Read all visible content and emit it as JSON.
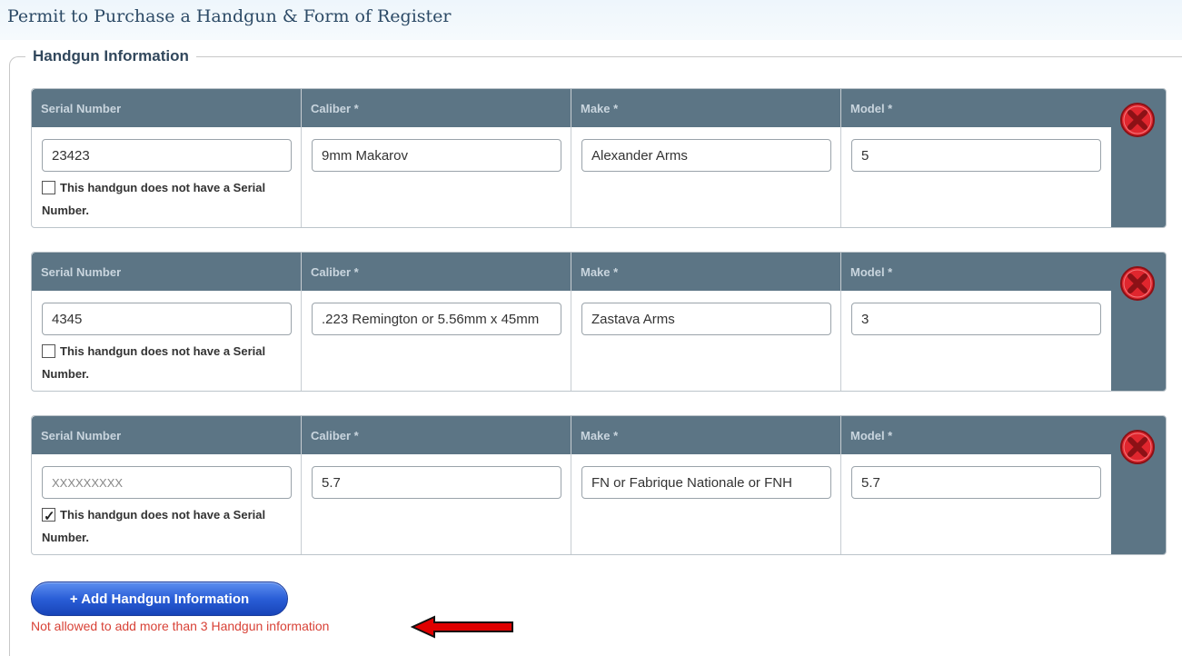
{
  "page": {
    "title": "Permit to Purchase a Handgun & Form of Register"
  },
  "fieldset": {
    "legend": "Handgun Information"
  },
  "columns": {
    "serial": "Serial Number",
    "caliber": "Caliber *",
    "make": "Make *",
    "model": "Model *"
  },
  "no_serial_label": "This handgun does not have a Serial Number.",
  "handguns": [
    {
      "serial": "23423",
      "serial_placeholder": "",
      "no_serial_checked": false,
      "caliber": "9mm Makarov",
      "make": "Alexander Arms",
      "model": "5"
    },
    {
      "serial": "4345",
      "serial_placeholder": "",
      "no_serial_checked": false,
      "caliber": ".223 Remington or 5.56mm x 45mm",
      "make": "Zastava Arms",
      "model": "3"
    },
    {
      "serial": "",
      "serial_placeholder": "XXXXXXXXX",
      "no_serial_checked": true,
      "caliber": "5.7",
      "make": "FN or Fabrique Nationale or FNH",
      "model": "5.7"
    }
  ],
  "actions": {
    "add_label": "+ Add Handgun Information",
    "error_message": "Not allowed to add more than 3 Handgun information"
  },
  "colors": {
    "table_header": "#5c7585",
    "delete_icon": "#e0262e",
    "add_button": "#2a5ed7",
    "error_text": "#d84237",
    "arrow": "#e00000"
  },
  "icons": {
    "delete": "close-circle-icon",
    "arrow": "left-arrow-icon"
  }
}
